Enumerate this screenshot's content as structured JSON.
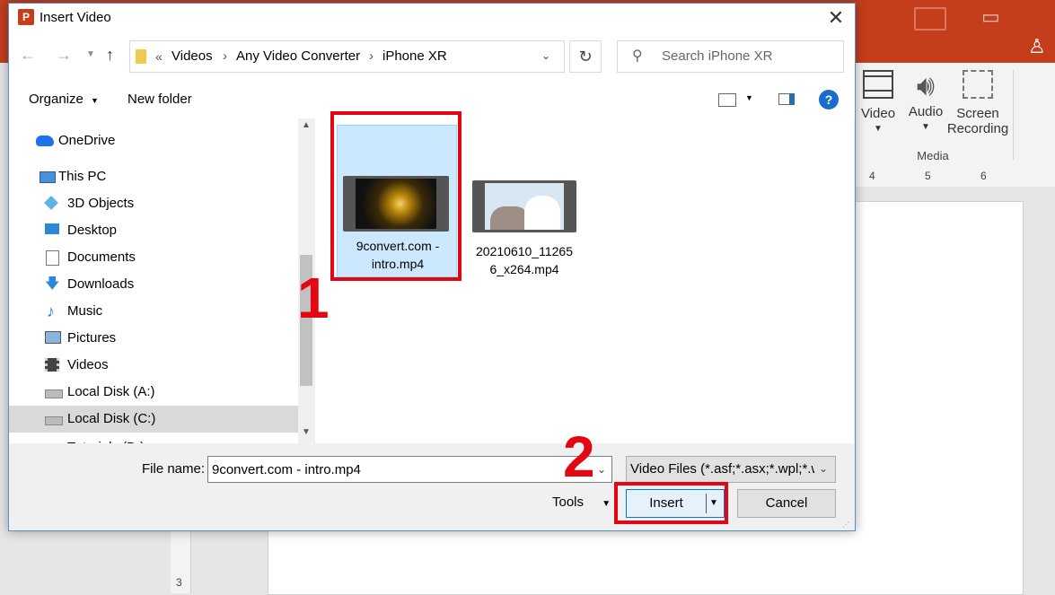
{
  "dialog": {
    "title": "Insert Video",
    "address": {
      "overflow": "«",
      "crumbs": [
        "Videos",
        "Any Video Converter",
        "iPhone XR"
      ]
    },
    "search": {
      "placeholder": "Search iPhone XR"
    },
    "toolbar": {
      "organize": "Organize",
      "new_folder": "New folder",
      "help": "?"
    },
    "nav": {
      "items": [
        {
          "label": "OneDrive",
          "icon": "cloud-icon"
        },
        {
          "label": "This PC",
          "icon": "computer-icon"
        },
        {
          "label": "3D Objects",
          "icon": "cube-icon"
        },
        {
          "label": "Desktop",
          "icon": "desktop-icon"
        },
        {
          "label": "Documents",
          "icon": "documents-icon"
        },
        {
          "label": "Downloads",
          "icon": "download-arrow-icon"
        },
        {
          "label": "Music",
          "icon": "music-note-icon"
        },
        {
          "label": "Pictures",
          "icon": "pictures-icon"
        },
        {
          "label": "Videos",
          "icon": "film-icon"
        },
        {
          "label": "Local Disk (A:)",
          "icon": "drive-icon"
        },
        {
          "label": "Local Disk (C:)",
          "icon": "windows-drive-icon"
        },
        {
          "label": "Tutorials (D:)",
          "icon": "drive-icon"
        }
      ]
    },
    "files": [
      {
        "name": "9convert.com - intro.mp4",
        "name_line1": "9convert.com -",
        "name_line2": "intro.mp4",
        "selected": true
      },
      {
        "name": "20210610_112656_x264.mp4",
        "name_line1": "20210610_11265",
        "name_line2": "6_x264.mp4",
        "selected": false
      }
    ],
    "bottom": {
      "file_name_label": "File name:",
      "file_name_value": "9convert.com - intro.mp4",
      "filter": "Video Files (*.asf;*.asx;*.wpl;*.wr",
      "tools": "Tools",
      "insert": "Insert",
      "cancel": "Cancel"
    }
  },
  "annotations": {
    "step1": "1",
    "step2": "2",
    "color": "#e30613"
  },
  "powerpoint": {
    "ribbon": {
      "video": "Video",
      "audio": "Audio",
      "screen_line1": "Screen",
      "screen_line2": "Recording",
      "group": "Media"
    },
    "ruler_marks": [
      "4",
      "5",
      "6"
    ],
    "vruler_mark": "3",
    "accent": "#c43e1c"
  }
}
